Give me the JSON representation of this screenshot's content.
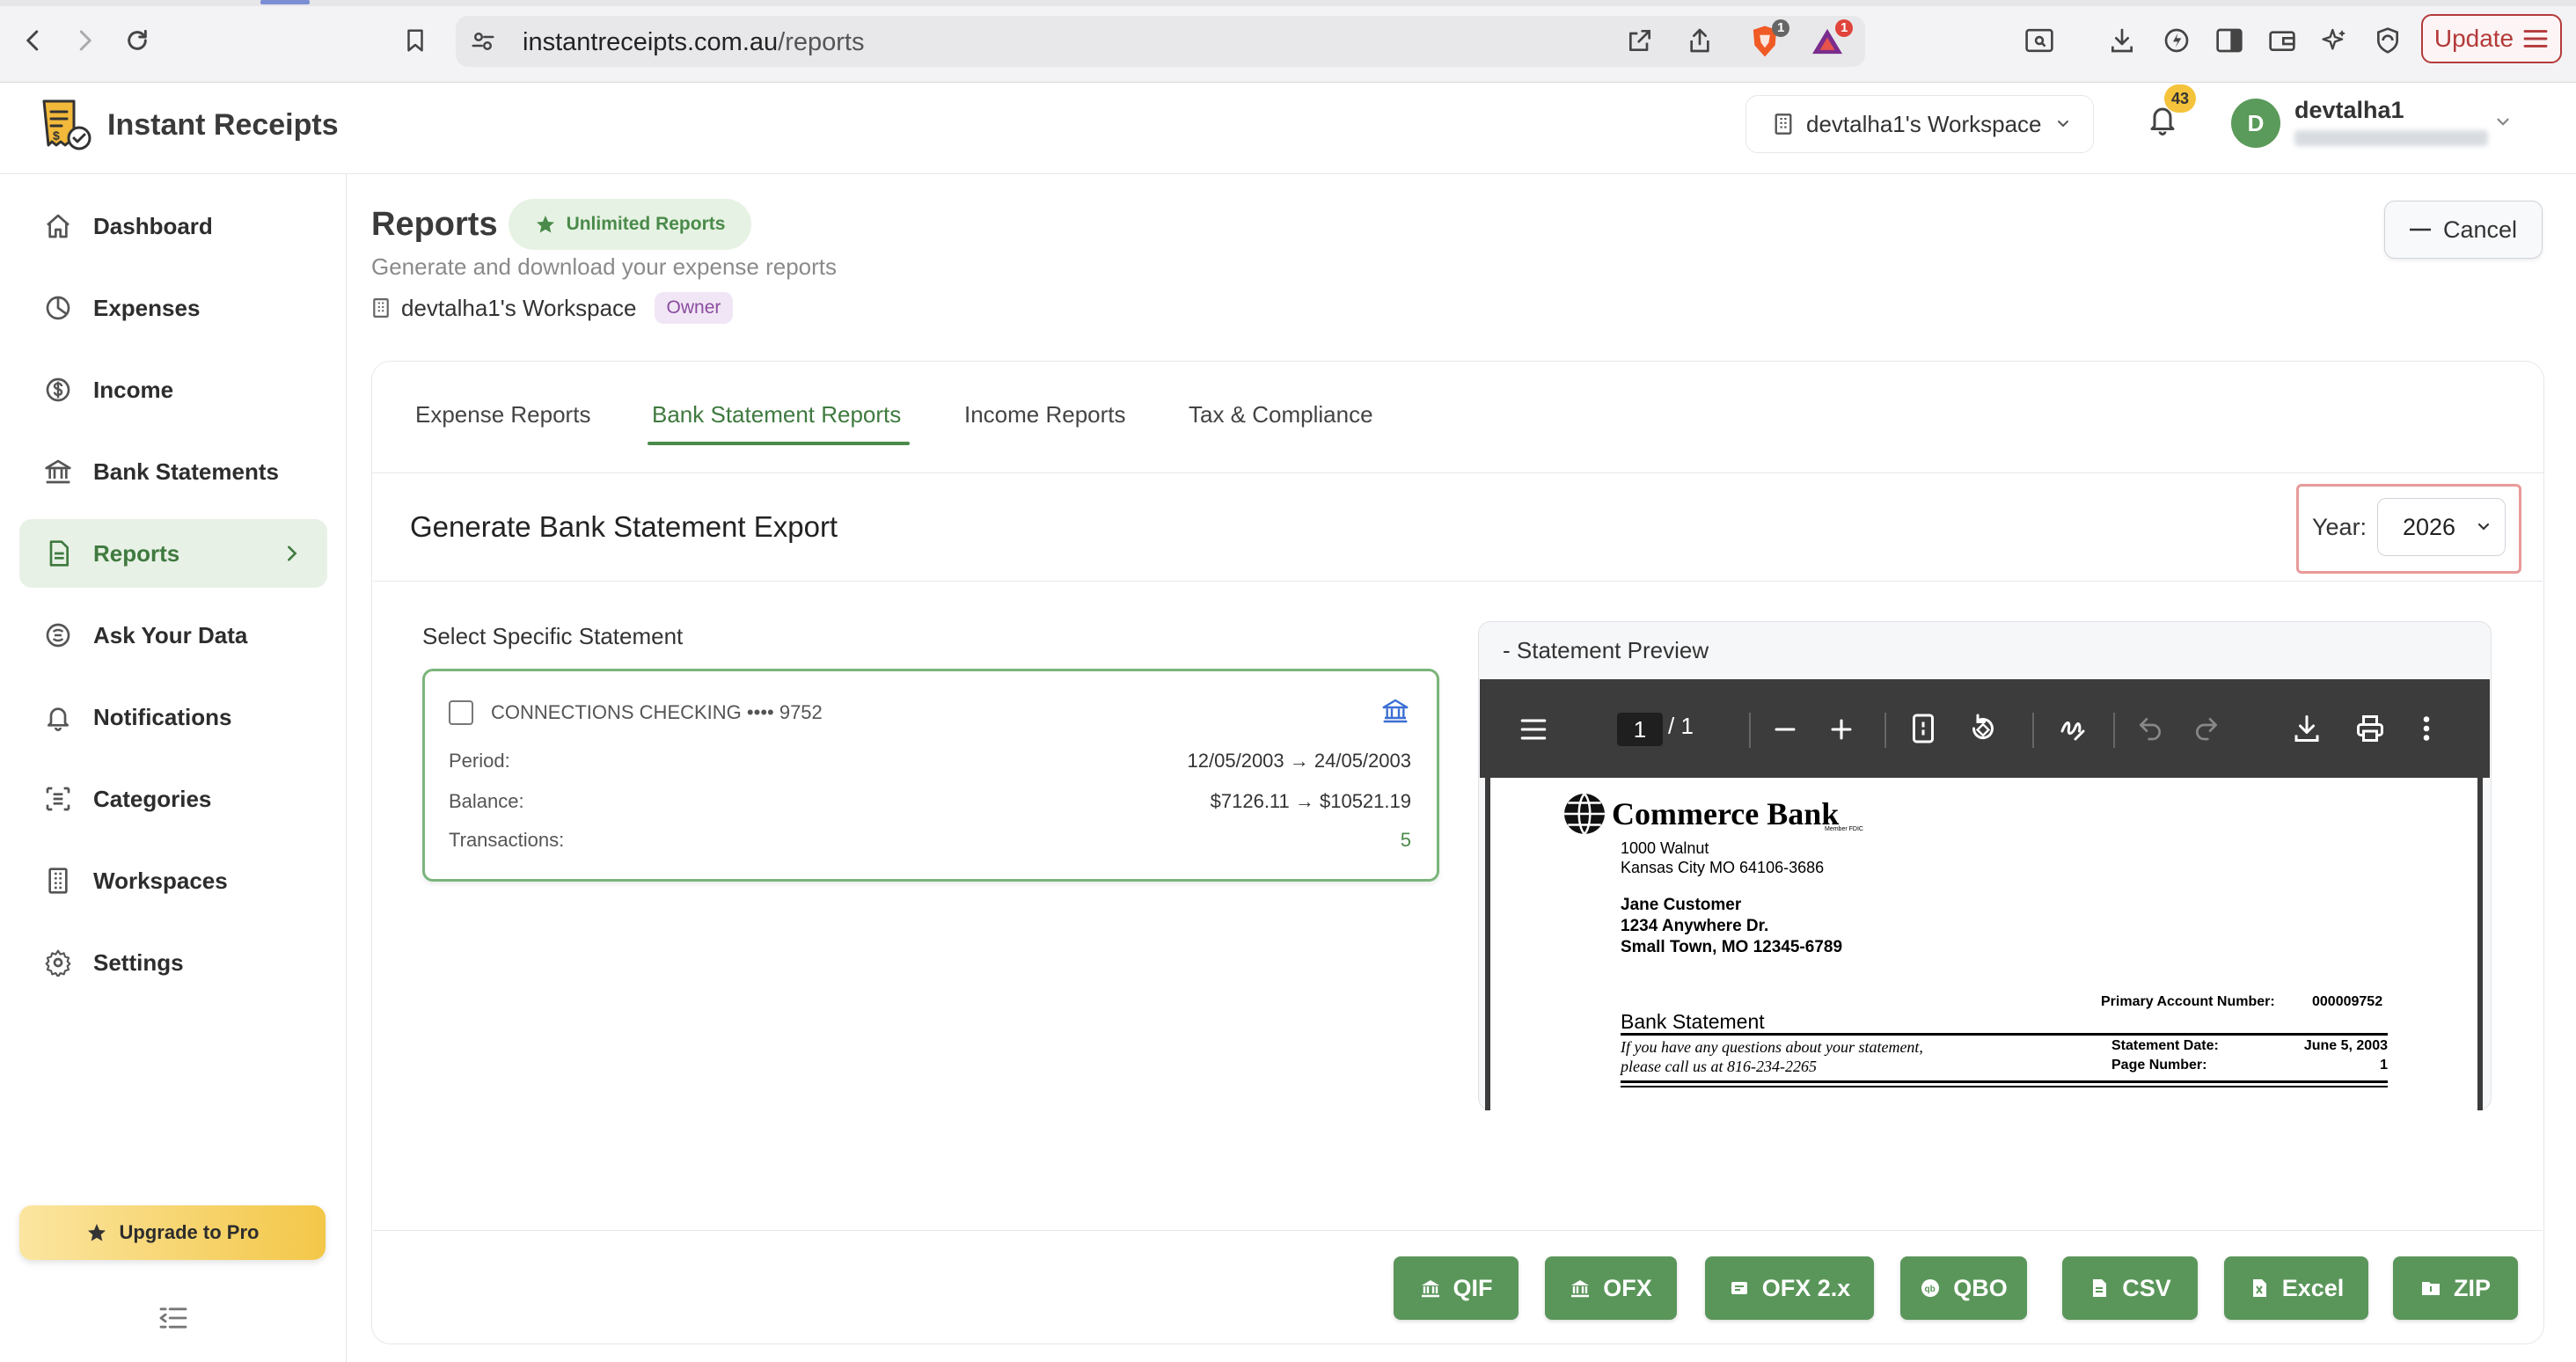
{
  "browser": {
    "url_domain": "instantreceipts.com.au",
    "url_path": "/reports",
    "shield_count": "1",
    "alert_count": "1",
    "update_label": "Update"
  },
  "header": {
    "brand": "Instant Receipts",
    "workspace": "devtalha1's Workspace",
    "notification_count": "43",
    "avatar_initial": "D",
    "username": "devtalha1"
  },
  "sidebar": {
    "items": [
      {
        "label": "Dashboard",
        "icon": "home-icon"
      },
      {
        "label": "Expenses",
        "icon": "pie-chart-icon"
      },
      {
        "label": "Income",
        "icon": "dollar-circle-icon"
      },
      {
        "label": "Bank Statements",
        "icon": "bank-icon"
      },
      {
        "label": "Reports",
        "icon": "document-icon",
        "active": true
      },
      {
        "label": "Ask Your Data",
        "icon": "ai-icon"
      },
      {
        "label": "Notifications",
        "icon": "bell-icon"
      },
      {
        "label": "Categories",
        "icon": "categories-icon"
      },
      {
        "label": "Workspaces",
        "icon": "building-icon"
      },
      {
        "label": "Settings",
        "icon": "gear-icon"
      }
    ],
    "upgrade_label": "Upgrade to Pro"
  },
  "page": {
    "title": "Reports",
    "unlimited_badge": "Unlimited Reports",
    "subtitle": "Generate and download your expense reports",
    "workspace": "devtalha1's Workspace",
    "role": "Owner",
    "cancel_label": "Cancel"
  },
  "tabs": [
    "Expense Reports",
    "Bank Statement Reports",
    "Income Reports",
    "Tax & Compliance"
  ],
  "active_tab": "Bank Statement Reports",
  "export": {
    "title": "Generate Bank Statement Export",
    "year_label": "Year:",
    "year_value": "2026",
    "select_label": "Select Specific Statement",
    "statement": {
      "account": "CONNECTIONS CHECKING •••• 9752",
      "period_label": "Period:",
      "period": "12/05/2003 → 24/05/2003",
      "balance_label": "Balance:",
      "balance": "$7126.11 → $10521.19",
      "transactions_label": "Transactions:",
      "transactions": "5"
    }
  },
  "preview": {
    "title": "- Statement Preview",
    "page_current": "1",
    "page_total": "/ 1",
    "doc": {
      "bank_name": "Commerce Bank",
      "member": "Member FDIC",
      "addr1": "1000 Walnut",
      "addr2": "Kansas City MO 64106-3686",
      "cust1": "Jane Customer",
      "cust2": "1234 Anywhere Dr.",
      "cust3": "Small Town, MO 12345-6789",
      "pan_label": "Primary Account Number:",
      "pan_value": "000009752",
      "heading": "Bank Statement",
      "q1": "If you have any questions about your statement,",
      "q2": "please call us at 816-234-2265",
      "date_label": "Statement Date:",
      "date_value": "June 5, 2003",
      "page_label": "Page Number:",
      "page_value": "1"
    }
  },
  "exports": [
    "QIF",
    "OFX",
    "OFX 2.x",
    "QBO",
    "CSV",
    "Excel",
    "ZIP"
  ],
  "colors": {
    "brand_green": "#5a965a",
    "active_green": "#3f7a3f",
    "highlight": "#e89a9a"
  }
}
